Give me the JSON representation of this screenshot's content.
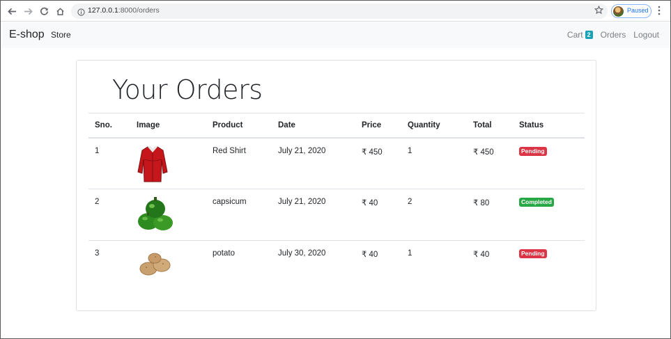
{
  "browser": {
    "url_host": "127.0.0.1",
    "url_path": ":8000/orders",
    "profile_label": "Paused"
  },
  "navbar": {
    "brand": "E-shop",
    "store_label": "Store",
    "cart_label": "Cart",
    "cart_count": "2",
    "orders_label": "Orders",
    "logout_label": "Logout"
  },
  "page": {
    "title": "Your Orders"
  },
  "table": {
    "headers": {
      "sno": "Sno.",
      "image": "Image",
      "product": "Product",
      "date": "Date",
      "price": "Price",
      "quantity": "Quantity",
      "total": "Total",
      "status": "Status"
    },
    "rows": [
      {
        "sno": "1",
        "image_icon": "red-shirt-image",
        "product": "Red Shirt",
        "date": "July 21, 2020",
        "price": "₹ 450",
        "quantity": "1",
        "total": "₹ 450",
        "status": "Pending"
      },
      {
        "sno": "2",
        "image_icon": "capsicum-image",
        "product": "capsicum",
        "date": "July 21, 2020",
        "price": "₹ 40",
        "quantity": "2",
        "total": "₹ 80",
        "status": "Completed"
      },
      {
        "sno": "3",
        "image_icon": "potato-image",
        "product": "potato",
        "date": "July 30, 2020",
        "price": "₹ 40",
        "quantity": "1",
        "total": "₹ 40",
        "status": "Pending"
      }
    ]
  },
  "colors": {
    "pending": "#dc3545",
    "completed": "#28a745",
    "cart_badge": "#17a2b8"
  }
}
